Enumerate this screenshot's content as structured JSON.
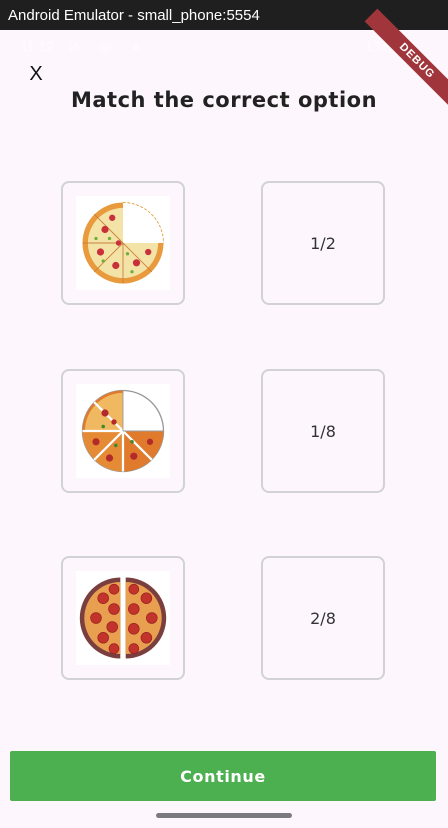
{
  "window": {
    "title": "Android Emulator - small_phone:5554"
  },
  "status_bar": {
    "time": "11:12",
    "network": "LTE",
    "debug_banner": "DEBUG"
  },
  "header": {
    "close_label": "X",
    "title": "Match the correct option"
  },
  "left_options": [
    {
      "image": "pizza-seven-eighths-icon"
    },
    {
      "image": "pizza-quarter-missing-icon"
    },
    {
      "image": "pizza-half-split-icon"
    }
  ],
  "right_options": [
    {
      "label": "1/2"
    },
    {
      "label": "1/8"
    },
    {
      "label": "2/8"
    }
  ],
  "footer": {
    "continue_label": "Continue"
  },
  "colors": {
    "accent": "#4caf50",
    "background": "#fdf7fd",
    "card_border": "#d2d2d6"
  }
}
